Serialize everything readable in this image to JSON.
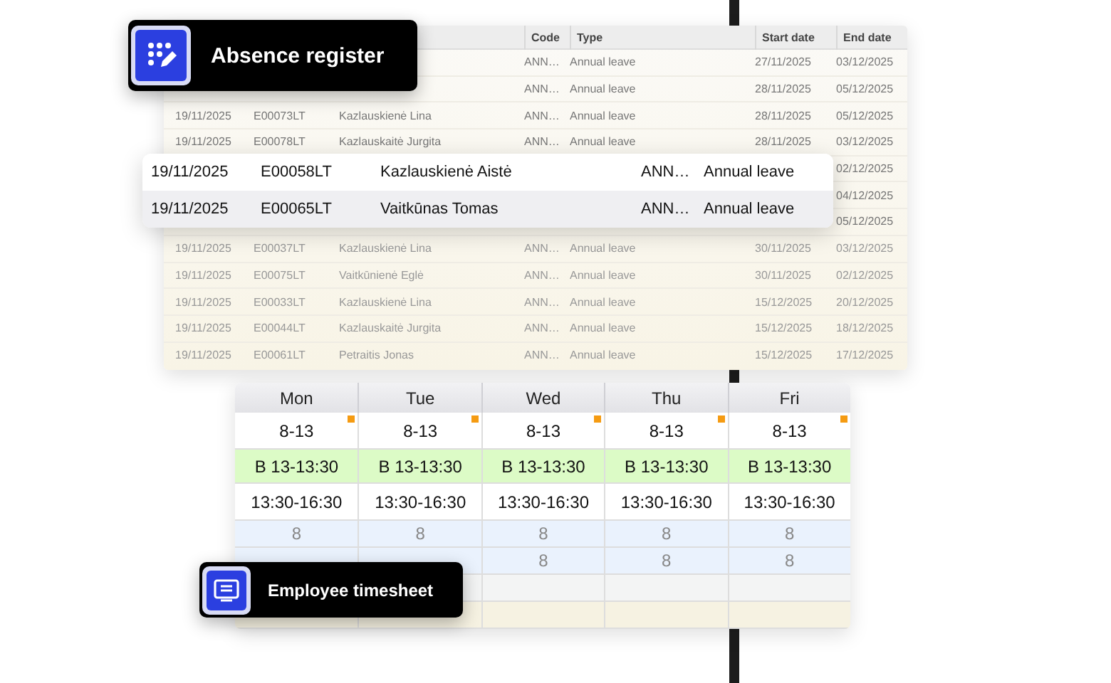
{
  "absence_register": {
    "badge": {
      "title": "Absence register"
    },
    "columns": [
      "Code",
      "Type",
      "Start date",
      "End date"
    ],
    "rows": [
      {
        "code": "ANN…",
        "type": "Annual leave",
        "start": "27/11/2025",
        "end": "03/12/2025"
      },
      {
        "code": "ANN…",
        "type": "Annual leave",
        "start": "28/11/2025",
        "end": "05/12/2025"
      },
      {
        "date": "19/11/2025",
        "id": "E00073LT",
        "name": "Kazlauskienė Lina",
        "code": "ANN…",
        "type": "Annual leave",
        "start": "28/11/2025",
        "end": "05/12/2025"
      },
      {
        "date": "19/11/2025",
        "id": "E00078LT",
        "name": "Kazlauskaitė Jurgita",
        "code": "ANN…",
        "type": "Annual leave",
        "start": "28/11/2025",
        "end": "03/12/2025"
      },
      {
        "end": "02/12/2025"
      },
      {
        "end": "04/12/2025"
      },
      {
        "end": "05/12/2025"
      },
      {
        "date": "19/11/2025",
        "id": "E00037LT",
        "name": "Kazlauskienė Lina",
        "code": "ANN…",
        "type": "Annual leave",
        "start": "30/11/2025",
        "end": "03/12/2025"
      },
      {
        "date": "19/11/2025",
        "id": "E00075LT",
        "name": "Vaitkūnienė Eglė",
        "code": "ANN…",
        "type": "Annual leave",
        "start": "30/11/2025",
        "end": "02/12/2025"
      },
      {
        "date": "19/11/2025",
        "id": "E00033LT",
        "name": "Kazlauskienė Lina",
        "code": "ANN…",
        "type": "Annual leave",
        "start": "15/12/2025",
        "end": "20/12/2025"
      },
      {
        "date": "19/11/2025",
        "id": "E00044LT",
        "name": "Kazlauskaitė Jurgita",
        "code": "ANN…",
        "type": "Annual leave",
        "start": "15/12/2025",
        "end": "18/12/2025"
      },
      {
        "date": "19/11/2025",
        "id": "E00061LT",
        "name": "Petraitis Jonas",
        "code": "ANN…",
        "type": "Annual leave",
        "start": "15/12/2025",
        "end": "17/12/2025"
      }
    ],
    "highlighted_rows": [
      {
        "date": "19/11/2025",
        "id": "E00058LT",
        "name": "Kazlauskienė Aistė",
        "code": "ANN…",
        "type": "Annual leave",
        "selected": false
      },
      {
        "date": "19/11/2025",
        "id": "E00065LT",
        "name": "Vaitkūnas Tomas",
        "code": "ANN…",
        "type": "Annual leave",
        "selected": true
      }
    ]
  },
  "timesheet": {
    "badge": {
      "title": "Employee timesheet"
    },
    "days": [
      "Mon",
      "Tue",
      "Wed",
      "Thu",
      "Fri"
    ],
    "rows": [
      {
        "kind": "shift",
        "flagged": true,
        "cells": [
          "8-13",
          "8-13",
          "8-13",
          "8-13",
          "8-13"
        ]
      },
      {
        "kind": "break",
        "flagged": false,
        "cells": [
          "B 13-13:30",
          "B 13-13:30",
          "B 13-13:30",
          "B 13-13:30",
          "B 13-13:30"
        ]
      },
      {
        "kind": "shift",
        "flagged": false,
        "cells": [
          "13:30-16:30",
          "13:30-16:30",
          "13:30-16:30",
          "13:30-16:30",
          "13:30-16:30"
        ]
      },
      {
        "kind": "hours",
        "flagged": false,
        "cells": [
          "8",
          "8",
          "8",
          "8",
          "8"
        ]
      },
      {
        "kind": "hours",
        "flagged": false,
        "cells": [
          null,
          null,
          "8",
          "8",
          "8"
        ]
      },
      {
        "kind": "empty",
        "flagged": false,
        "cells": [
          null,
          null,
          null,
          null,
          null
        ]
      },
      {
        "kind": "total",
        "flagged": false,
        "cells": [
          null,
          null,
          null,
          null,
          null
        ]
      }
    ]
  }
}
